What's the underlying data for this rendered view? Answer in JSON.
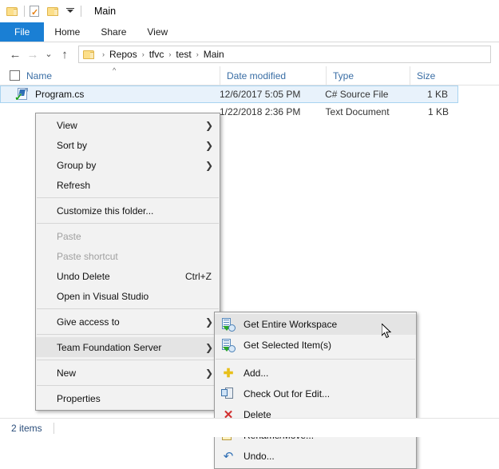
{
  "window": {
    "title": "Main",
    "quick_access": [
      {
        "name": "folder-icon",
        "label": "Folder"
      },
      {
        "name": "properties-icon",
        "label": "Properties"
      },
      {
        "name": "new-folder-icon",
        "label": "New folder"
      },
      {
        "name": "customize-dropdown-icon",
        "label": "Customize Quick Access Toolbar"
      }
    ]
  },
  "ribbon": {
    "tabs": [
      {
        "label": "File",
        "active": true
      },
      {
        "label": "Home",
        "active": false
      },
      {
        "label": "Share",
        "active": false
      },
      {
        "label": "View",
        "active": false
      }
    ]
  },
  "navbar": {
    "back_label": "←",
    "forward_label": "→",
    "recent_label": "⌄",
    "up_label": "↑",
    "breadcrumbs": [
      "Repos",
      "tfvc",
      "test",
      "Main"
    ],
    "separator": "›"
  },
  "columns": [
    {
      "label": "Name",
      "sort": "ascending"
    },
    {
      "label": "Date modified",
      "sort": ""
    },
    {
      "label": "Type",
      "sort": ""
    },
    {
      "label": "Size",
      "sort": ""
    }
  ],
  "files": [
    {
      "name": "Program.cs",
      "date_modified": "12/6/2017 5:05 PM",
      "type": "C# Source File",
      "size": "1 KB",
      "selected": true,
      "icon": "csharp-file-icon"
    },
    {
      "name": "",
      "date_modified": "1/22/2018 2:36 PM",
      "type": "Text Document",
      "size": "1 KB",
      "selected": false,
      "icon": "text-file-icon"
    }
  ],
  "status": {
    "item_count": "2 items"
  },
  "context_menu": {
    "items": [
      {
        "label": "View",
        "submenu": true,
        "disabled": false,
        "accel": ""
      },
      {
        "label": "Sort by",
        "submenu": true,
        "disabled": false,
        "accel": ""
      },
      {
        "label": "Group by",
        "submenu": true,
        "disabled": false,
        "accel": ""
      },
      {
        "label": "Refresh",
        "submenu": false,
        "disabled": false,
        "accel": ""
      },
      {
        "label": "Customize this folder...",
        "submenu": false,
        "disabled": false,
        "accel": ""
      },
      {
        "label": "Paste",
        "submenu": false,
        "disabled": true,
        "accel": ""
      },
      {
        "label": "Paste shortcut",
        "submenu": false,
        "disabled": true,
        "accel": ""
      },
      {
        "label": "Undo Delete",
        "submenu": false,
        "disabled": false,
        "accel": "Ctrl+Z"
      },
      {
        "label": "Open in Visual Studio",
        "submenu": false,
        "disabled": false,
        "accel": ""
      },
      {
        "label": "Give access to",
        "submenu": true,
        "disabled": false,
        "accel": ""
      },
      {
        "label": "Team Foundation Server",
        "submenu": true,
        "disabled": false,
        "accel": "",
        "highlighted": true
      },
      {
        "label": "New",
        "submenu": true,
        "disabled": false,
        "accel": ""
      },
      {
        "label": "Properties",
        "submenu": false,
        "disabled": false,
        "accel": ""
      }
    ]
  },
  "tfs_submenu": {
    "items": [
      {
        "label": "Get Entire Workspace",
        "icon": "get-workspace-icon",
        "highlighted": true
      },
      {
        "label": "Get Selected Item(s)",
        "icon": "get-selected-icon",
        "highlighted": false
      },
      {
        "label": "Add...",
        "icon": "add-icon",
        "highlighted": false
      },
      {
        "label": "Check Out for Edit...",
        "icon": "check-out-icon",
        "highlighted": false
      },
      {
        "label": "Delete",
        "icon": "delete-icon",
        "highlighted": false
      },
      {
        "label": "Rename/Move...",
        "icon": "rename-move-icon",
        "highlighted": false
      },
      {
        "label": "Undo...",
        "icon": "undo-icon",
        "highlighted": false
      }
    ]
  },
  "colors": {
    "accent": "#1a7fd4",
    "selection": "#e8f2fb",
    "menu_bg": "#f2f2f2",
    "menu_highlight": "#e4e4e4",
    "header_text": "#3a6ea5"
  }
}
